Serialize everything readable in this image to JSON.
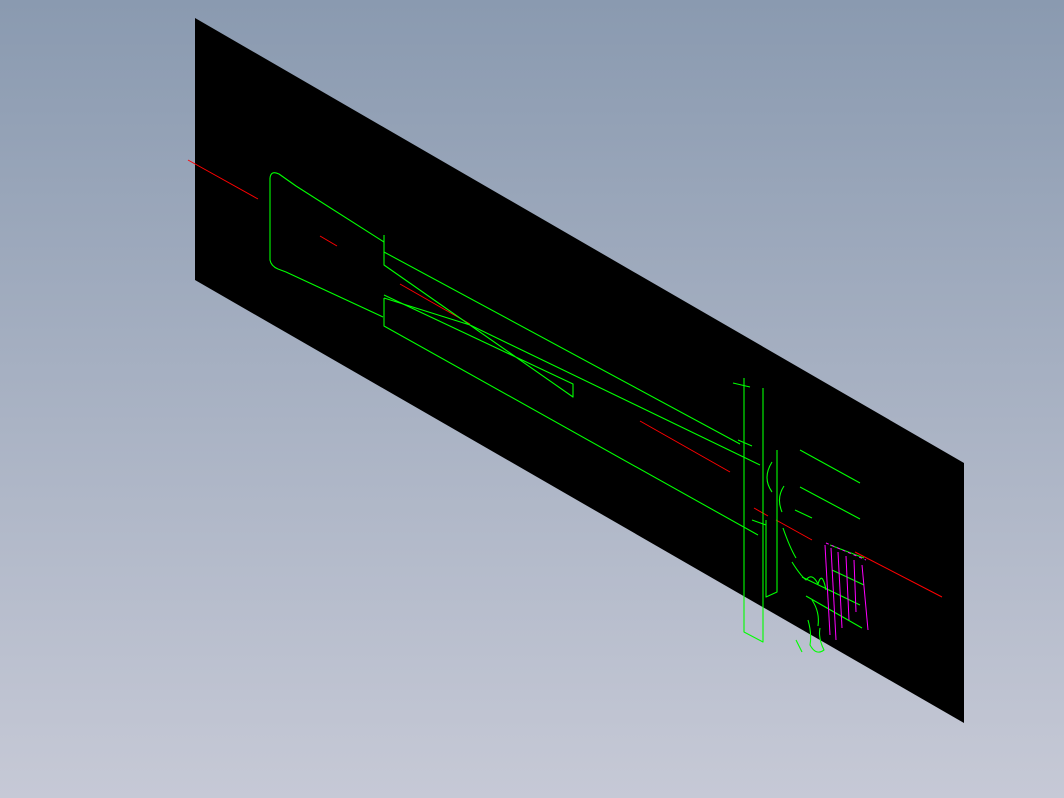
{
  "viewport": {
    "background_top": "#8a9ab0",
    "background_bottom": "#c6c9d6",
    "sheet_color": "#000000"
  },
  "drawing": {
    "outline_color": "#00ff00",
    "centerline_color": "#ff0000",
    "detail_color": "#ff00ff"
  }
}
